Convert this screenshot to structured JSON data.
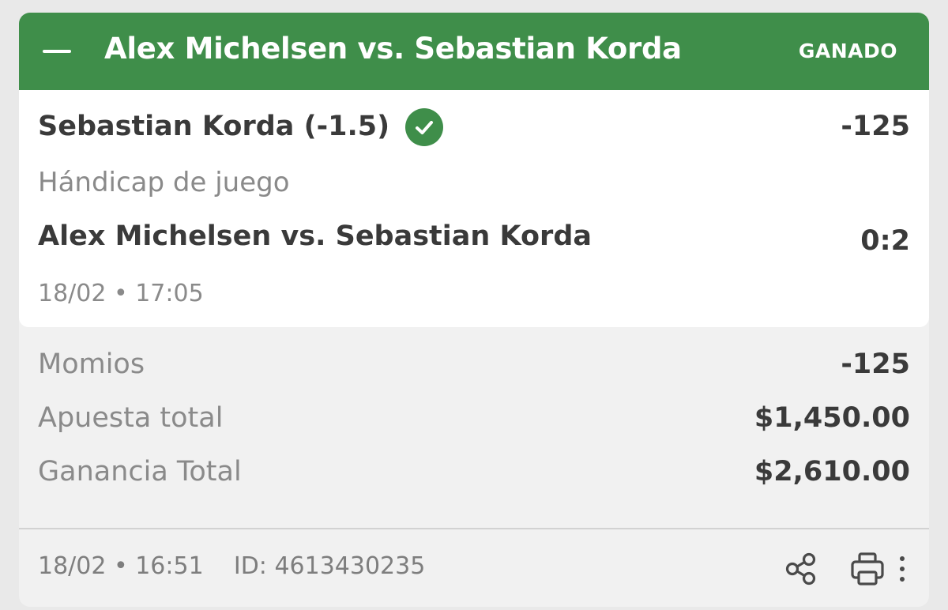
{
  "header": {
    "title": "Alex Michelsen vs. Sebastian Korda",
    "status": "GANADO"
  },
  "bet": {
    "selection": "Sebastian Korda (-1.5)",
    "odds": "-125",
    "market": "Hándicap de juego",
    "event": "Alex Michelsen vs. Sebastian Korda",
    "score": "0:2",
    "event_datetime": "18/02 • 17:05"
  },
  "summary": {
    "odds_label": "Momios",
    "odds_value": "-125",
    "stake_label": "Apuesta total",
    "stake_value": "$1,450.00",
    "payout_label": "Ganancia Total",
    "payout_value": "$2,610.00"
  },
  "footer": {
    "placed_datetime": "18/02 • 16:51",
    "id_text": "ID: 4613430235"
  },
  "icons": {
    "collapse": "minus-icon",
    "won": "check-circle-icon",
    "share": "share-icon",
    "print": "print-icon",
    "more": "more-vertical-icon"
  },
  "colors": {
    "accent_green": "#3f8e4a",
    "text_dark": "#3a3a3a",
    "text_muted": "#8a8a8a",
    "card_bg": "#f1f1f1",
    "panel_bg": "#ffffff"
  }
}
